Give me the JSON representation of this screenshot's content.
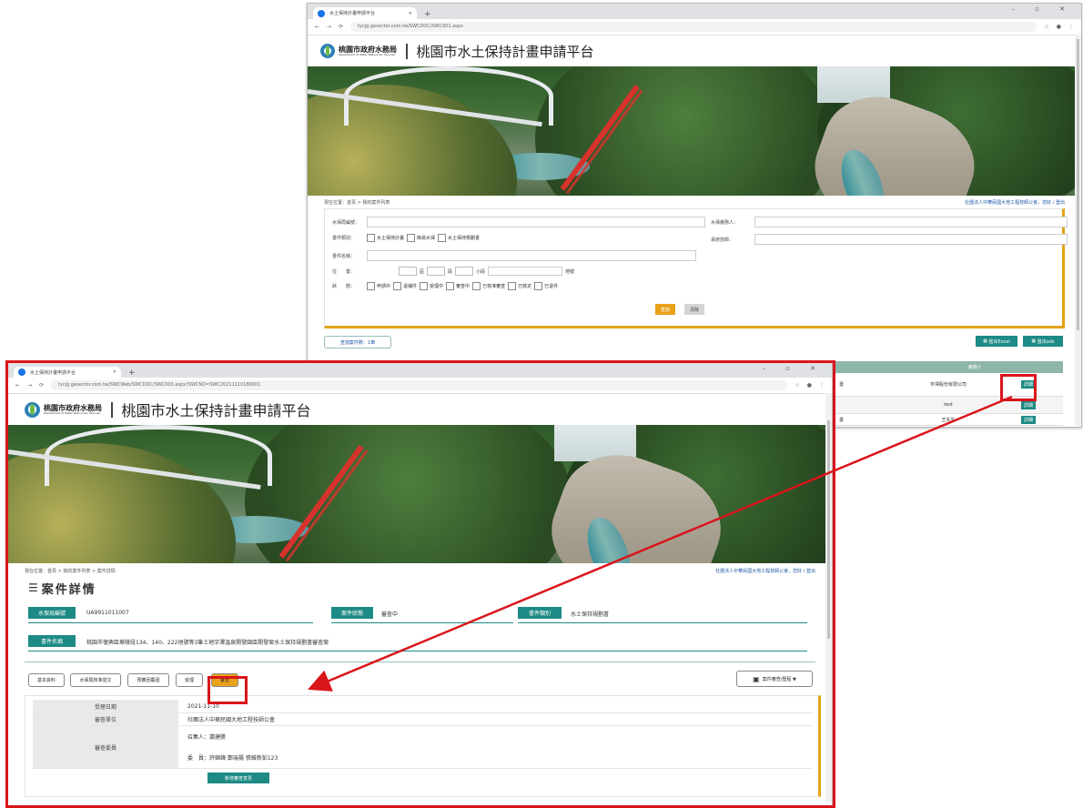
{
  "browser_back": {
    "tab_title": "水土保持計畫申請平台",
    "url": "tycjg.gesector.com.tw/SWCDOC/SWC001.aspx",
    "new_tab": "+",
    "win_controls": "– ▫ ✕"
  },
  "browser_front": {
    "tab_title": "水土保持計畫申請平台",
    "url": "tycjg.gesector.com.tw/SWCWeb/SWCDOC/SWC003.aspx?SWCNO=SWC20211110180001",
    "new_tab": "+",
    "win_controls": "– ▫ ✕"
  },
  "site": {
    "logo_cn": "桃園市政府水務局",
    "logo_en": "Department of Water Resources, Taoyuan",
    "title": "桃園市水土保持計畫申請平台"
  },
  "back_page": {
    "breadcrumb": "現在位置：首頁 > 我的案件列表",
    "user_info": "社團法人中華民國大地工程技師公會，您好 / 登出",
    "form": {
      "labels": {
        "water_id": "水保局編號：",
        "applicant": "水保義務人：",
        "case_type": "書件類別：",
        "tech": "承辦技師：",
        "plan_name": "書件名稱：",
        "location": "位　　置：",
        "status": "狀　　態："
      },
      "case_types": [
        "水土保持計畫",
        "簡易水保",
        "水土保持規劃書"
      ],
      "location_parts": [
        "區",
        "段",
        "小段",
        "地號"
      ],
      "statuses": [
        "申請中",
        "退補件",
        "受理中",
        "審查中",
        "已核准審查",
        "已核定",
        "已退件"
      ]
    },
    "search_btn": "查詢",
    "clear_btn": "清除",
    "result_count": "查詢案件數：1筆",
    "export_excel": "匯出Excel",
    "export_ods": "匯出ods",
    "table_header": "義務人",
    "rows": [
      {
        "left": "書",
        "owner": "宇澤股份有限公司",
        "action": "詳細"
      },
      {
        "left": "",
        "owner": "test",
        "action": "詳細"
      },
      {
        "left": "書",
        "owner": "王先生",
        "action": "詳細"
      }
    ]
  },
  "front_page": {
    "breadcrumb": "現在位置：首頁 > 我的案件列表 > 案件詳情",
    "user_info": "社團法人中華民國大地工程技師公會，您好 / 登出",
    "heading": "案件詳情",
    "fields": {
      "water_id_label": "水保局編號",
      "water_id_value": "UA9911011007",
      "status_label": "案件狀態",
      "status_value": "審查中",
      "type_label": "書件類別",
      "type_value": "水土保持規劃書",
      "name_label": "書件名稱",
      "name_value": "桃園市復興區華陵段134、140、222地號等3筆土地宇澤溫泉開發園區開發案水土保持規劃書審查案"
    },
    "tabs": [
      "基本資料",
      "水保局核准發文",
      "預審回覆函",
      "受理",
      "審查"
    ],
    "active_tab_index": 4,
    "history_btn": "案件審查/歷程 ▼",
    "detail_rows": [
      {
        "label": "受理日期",
        "value": "2021-11-10"
      },
      {
        "label": "審查單位",
        "value": "社團法人中華民國大地工程技師公會"
      },
      {
        "label": "審查委員",
        "value_line1": "召集人：蕭建勝",
        "value_line2": "委　員：許錦鋒 鄭瑞揚 張維新彭123"
      }
    ],
    "bottom_btn": "新增審查意見"
  }
}
